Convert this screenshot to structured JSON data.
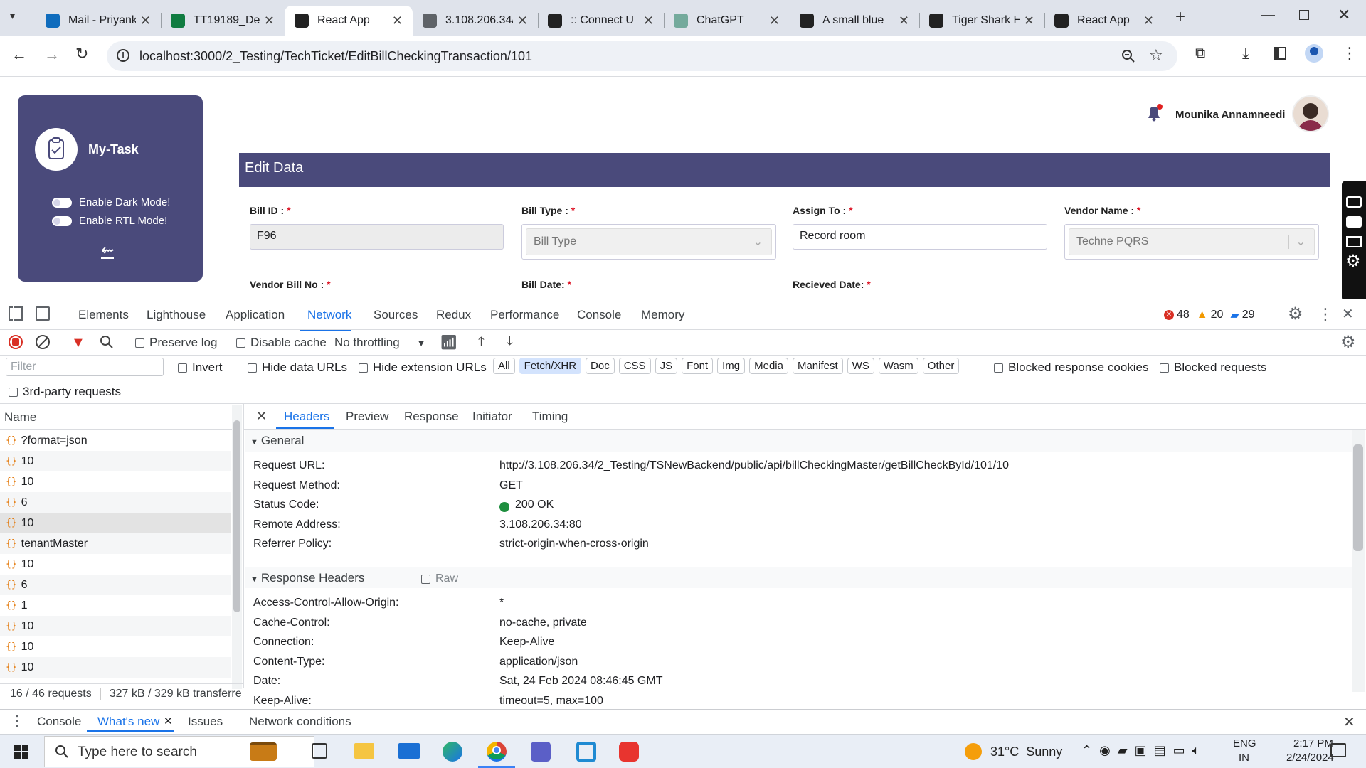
{
  "browser": {
    "tabs": [
      {
        "title": "Mail - Priyank",
        "icon": "outlook-icon",
        "color": "#0f6cbd"
      },
      {
        "title": "TT19189_Def",
        "icon": "excel-icon",
        "color": "#107c41"
      },
      {
        "title": "React App",
        "icon": "react-icon",
        "color": "#222"
      },
      {
        "title": "3.108.206.34/",
        "icon": "globe-icon",
        "color": "#5f6368"
      },
      {
        "title": ":: Connect U",
        "icon": "connect-icon",
        "color": "#222"
      },
      {
        "title": "ChatGPT",
        "icon": "chatgpt-icon",
        "color": "#74aa9c"
      },
      {
        "title": "A small blue",
        "icon": "image-icon",
        "color": "#222"
      },
      {
        "title": "Tiger Shark H",
        "icon": "s-icon",
        "color": "#222"
      },
      {
        "title": "React App",
        "icon": "react-icon",
        "color": "#222"
      }
    ],
    "url": "localhost:3000/2_Testing/TechTicket/EditBillCheckingTransaction/101"
  },
  "app": {
    "brand": "My-Task",
    "dark_mode_label": "Enable Dark Mode!",
    "rtl_label": "Enable RTL Mode!",
    "user_name": "Mounika Annamneedi",
    "edit_title": "Edit Data",
    "fields": {
      "bill_id_label": "Bill ID : ",
      "bill_id_value": "F96",
      "bill_type_label": "Bill Type : ",
      "bill_type_value": "Bill Type",
      "assign_to_label": "Assign To : ",
      "assign_to_value": "Record room",
      "vendor_name_label": "Vendor Name : ",
      "vendor_name_value": "Techne PQRS",
      "vendor_bill_no_label": "Vendor Bill No : ",
      "bill_date_label": "Bill Date: ",
      "received_date_label": "Recieved Date: ",
      "required_mark": "*"
    }
  },
  "devtools": {
    "tabs": [
      "Elements",
      "Lighthouse",
      "Application",
      "Network",
      "Sources",
      "Redux",
      "Performance",
      "Console",
      "Memory"
    ],
    "active_tab": "Network",
    "errors": "48",
    "warnings": "20",
    "messages": "29",
    "toolbar": {
      "preserve_log": "Preserve log",
      "disable_cache": "Disable cache",
      "throttling": "No throttling"
    },
    "filter_placeholder": "Filter",
    "invert": "Invert",
    "hide_data_urls": "Hide data URLs",
    "hide_ext_urls": "Hide extension URLs",
    "type_filters": [
      "All",
      "Fetch/XHR",
      "Doc",
      "CSS",
      "JS",
      "Font",
      "Img",
      "Media",
      "Manifest",
      "WS",
      "Wasm",
      "Other"
    ],
    "active_filter": "Fetch/XHR",
    "blocked_cookies": "Blocked response cookies",
    "blocked_requests": "Blocked requests",
    "third_party": "3rd-party requests",
    "name_header": "Name",
    "requests": [
      "?format=json",
      "10",
      "10",
      "6",
      "10",
      "tenantMaster",
      "10",
      "6",
      "1",
      "10",
      "10",
      "10"
    ],
    "selected_request_index": 4,
    "status_bar": {
      "count": "16 / 46 requests",
      "transfer": "327 kB / 329 kB transferre"
    },
    "detail_tabs": [
      "Headers",
      "Preview",
      "Response",
      "Initiator",
      "Timing"
    ],
    "general_title": "General",
    "general": [
      {
        "k": "Request URL:",
        "v": "http://3.108.206.34/2_Testing/TSNewBackend/public/api/billCheckingMaster/getBillCheckById/101/10"
      },
      {
        "k": "Request Method:",
        "v": "GET"
      },
      {
        "k": "Status Code:",
        "v": "200 OK"
      },
      {
        "k": "Remote Address:",
        "v": "3.108.206.34:80"
      },
      {
        "k": "Referrer Policy:",
        "v": "strict-origin-when-cross-origin"
      }
    ],
    "response_title": "Response Headers",
    "raw_label": "Raw",
    "response_headers": [
      {
        "k": "Access-Control-Allow-Origin:",
        "v": "*"
      },
      {
        "k": "Cache-Control:",
        "v": "no-cache, private"
      },
      {
        "k": "Connection:",
        "v": "Keep-Alive"
      },
      {
        "k": "Content-Type:",
        "v": "application/json"
      },
      {
        "k": "Date:",
        "v": "Sat, 24 Feb 2024 08:46:45 GMT"
      },
      {
        "k": "Keep-Alive:",
        "v": "timeout=5, max=100"
      }
    ],
    "drawer_tabs": [
      "Console",
      "What's new",
      "Issues",
      "Network conditions"
    ],
    "active_drawer": "What's new"
  },
  "taskbar": {
    "search_placeholder": "Type here to search",
    "weather": "31°C  Sunny",
    "lang1": "ENG",
    "lang2": "IN",
    "time": "2:17 PM",
    "date": "2/24/2024"
  },
  "colors": {
    "accent": "#4a4a7b",
    "devtools_blue": "#1a73e8",
    "status_ok": "#1e8e3e",
    "error": "#d93025",
    "warning": "#f29900"
  }
}
